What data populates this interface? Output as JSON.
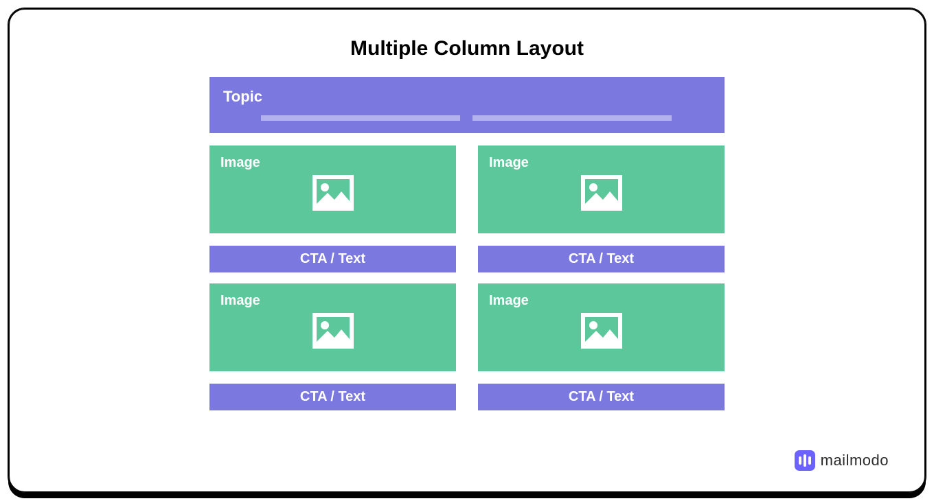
{
  "title": "Multiple Column Layout",
  "topic": {
    "label": "Topic"
  },
  "columns": [
    {
      "image_label": "Image",
      "cta_label": "CTA / Text"
    },
    {
      "image_label": "Image",
      "cta_label": "CTA / Text"
    },
    {
      "image_label": "Image",
      "cta_label": "CTA / Text"
    },
    {
      "image_label": "Image",
      "cta_label": "CTA / Text"
    }
  ],
  "brand": {
    "name": "mailmodo"
  },
  "colors": {
    "primary": "#7b79e0",
    "primary_light": "#b4b2ee",
    "accent": "#5bc79b",
    "brand": "#6c63ff"
  }
}
